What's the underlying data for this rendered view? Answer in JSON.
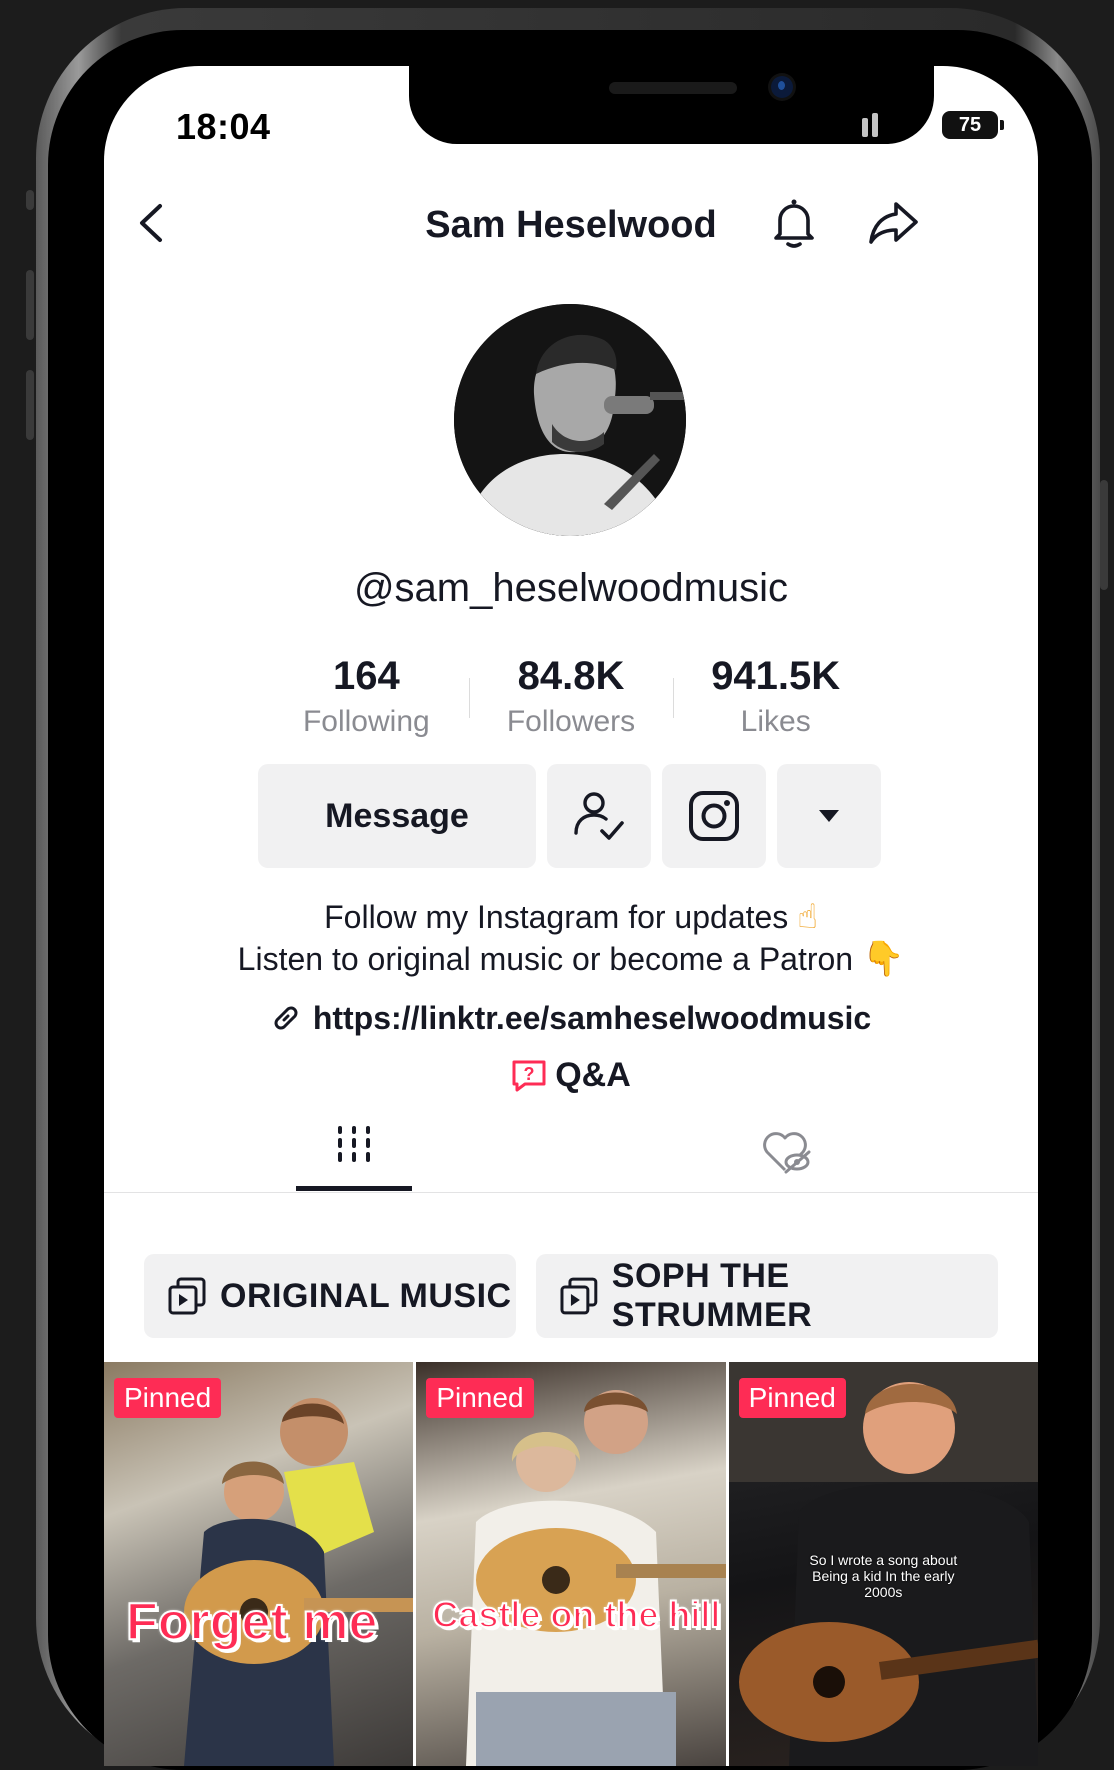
{
  "status_bar": {
    "time": "18:04",
    "battery": "75"
  },
  "header": {
    "title": "Sam Heselwood"
  },
  "profile": {
    "handle": "@sam_heselwoodmusic",
    "stats": [
      {
        "value": "164",
        "label": "Following"
      },
      {
        "value": "84.8K",
        "label": "Followers"
      },
      {
        "value": "941.5K",
        "label": "Likes"
      }
    ],
    "message_label": "Message",
    "bio_line1": "Follow my Instagram for updates",
    "bio_line2": "Listen to original music or become a Patron",
    "link": "https://linktr.ee/samheselwoodmusic",
    "qa_label": "Q&A"
  },
  "playlists": [
    {
      "label": "ORIGINAL MUSIC"
    },
    {
      "label": "SOPH THE STRUMMER"
    }
  ],
  "videos": [
    {
      "badge": "Pinned",
      "caption": "Forget me"
    },
    {
      "badge": "Pinned",
      "caption": "Castle on the hill"
    },
    {
      "badge": "Pinned",
      "caption": "So I wrote a song about Being a kid In the early 2000s"
    }
  ],
  "colors": {
    "accent": "#fe2c55",
    "text": "#161823",
    "muted": "#8a8b91",
    "button_bg": "#f1f1f2"
  },
  "icons": [
    "back-icon",
    "bell-icon",
    "share-icon",
    "friend-check-icon",
    "instagram-icon",
    "dropdown-icon",
    "link-icon",
    "qa-icon",
    "videos-grid-icon",
    "liked-hidden-icon",
    "playlist-icon"
  ]
}
